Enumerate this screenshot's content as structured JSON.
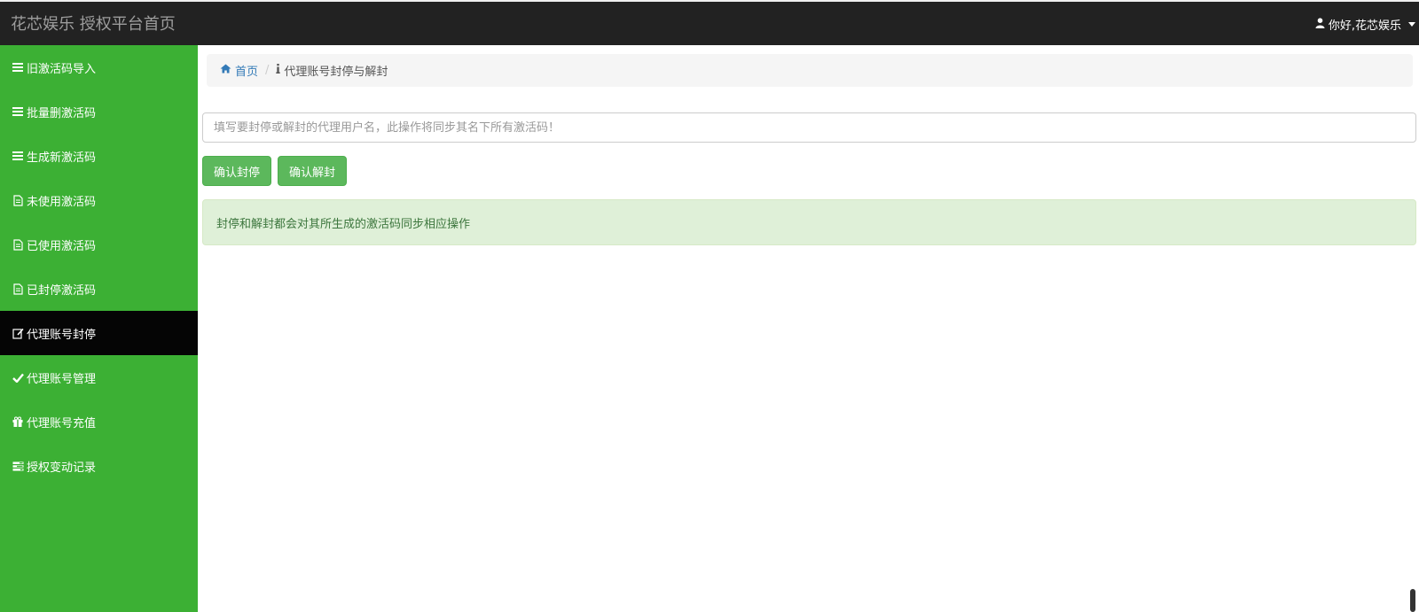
{
  "header": {
    "brand": "花芯娱乐 授权平台首页",
    "user_greeting": "你好,花芯娱乐"
  },
  "sidebar": {
    "items": [
      {
        "label": "旧激活码导入",
        "icon": "list-icon"
      },
      {
        "label": "批量删激活码",
        "icon": "list-icon"
      },
      {
        "label": "生成新激活码",
        "icon": "list-icon"
      },
      {
        "label": "未使用激活码",
        "icon": "file-icon"
      },
      {
        "label": "已使用激活码",
        "icon": "file-icon"
      },
      {
        "label": "已封停激活码",
        "icon": "file-icon"
      },
      {
        "label": "代理账号封停",
        "icon": "edit-icon",
        "active": true
      },
      {
        "label": "代理账号管理",
        "icon": "check-icon"
      },
      {
        "label": "代理账号充值",
        "icon": "gift-icon"
      },
      {
        "label": "授权变动记录",
        "icon": "tasks-icon"
      }
    ]
  },
  "breadcrumb": {
    "home": "首页",
    "current": "代理账号封停与解封"
  },
  "form": {
    "placeholder": "填写要封停或解封的代理用户名，此操作将同步其名下所有激活码！",
    "value": ""
  },
  "buttons": {
    "ban": "确认封停",
    "unban": "确认解封"
  },
  "alert": {
    "message": "封停和解封都会对其所生成的激活码同步相应操作"
  },
  "colors": {
    "sidebar": "#3cb034",
    "active_item": "#050505",
    "topbar": "#222222",
    "button": "#5cb85c",
    "alert_bg": "#dff0d8",
    "link": "#337ab7"
  }
}
